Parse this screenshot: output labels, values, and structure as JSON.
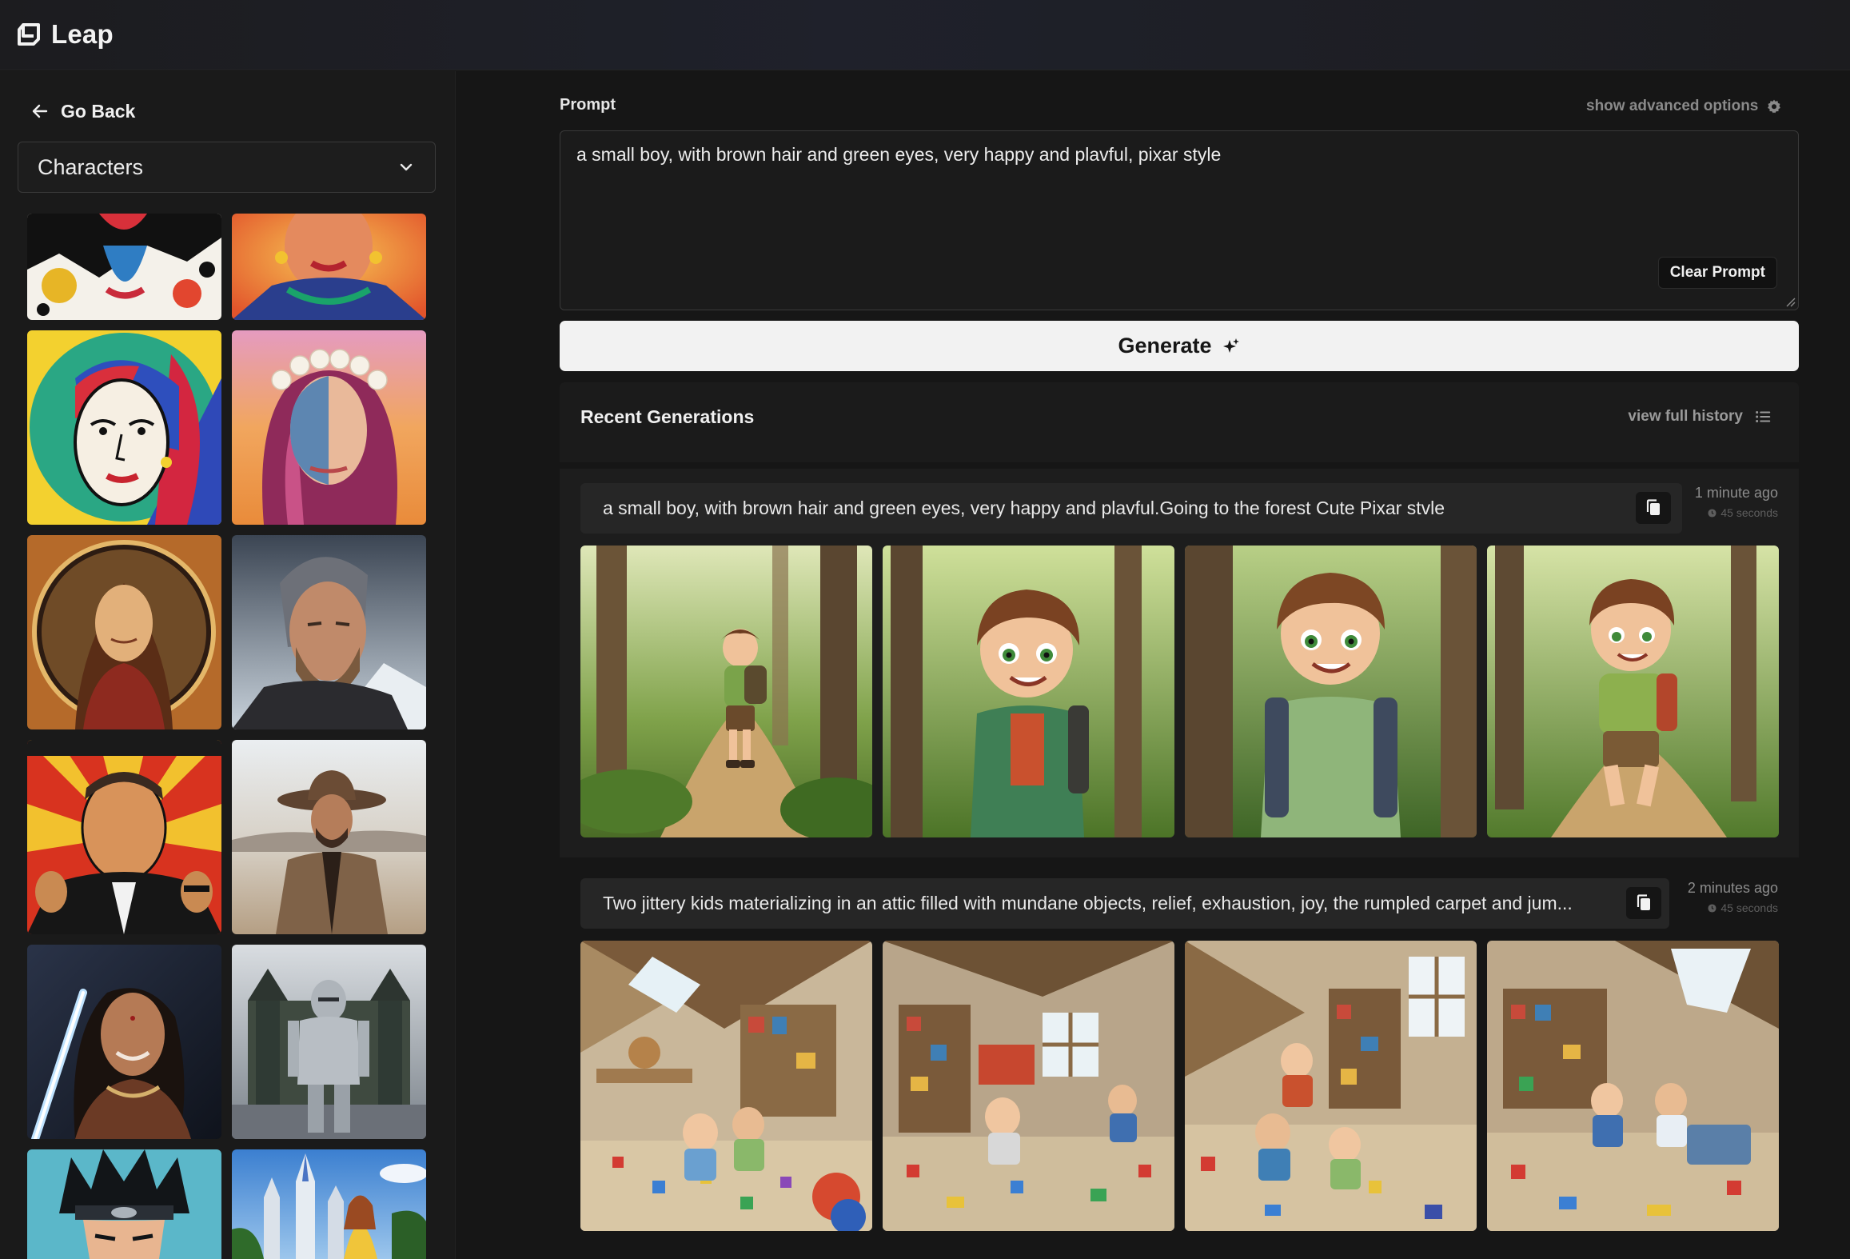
{
  "app": {
    "name": "Leap"
  },
  "sidebar": {
    "go_back_label": "Go Back",
    "category": {
      "selected": "Characters"
    },
    "tiles": [
      "pop-art-paint-splash-portrait",
      "pop-art-woman-with-necklace",
      "cubist-woman-portrait",
      "flower-crown-woman-portrait",
      "renaissance-woman-medallion",
      "viking-man-portrait",
      "retro-spy-poster",
      "cowboy-in-desert",
      "woman-with-lightsaber",
      "knight-in-armor",
      "anime-ninja",
      "princess-at-castle"
    ]
  },
  "prompt": {
    "label": "Prompt",
    "value": "a small boy, with brown hair and green eyes, very happy and plavful, pixar style",
    "advanced_label": "show advanced options",
    "clear_label": "Clear Prompt"
  },
  "generate": {
    "label": "Generate"
  },
  "recent": {
    "title": "Recent Generations",
    "view_history_label": "view full history",
    "generations": [
      {
        "prompt": "a small boy, with brown hair and green eyes, very happy and plavful.Going to the forest Cute Pixar stvle",
        "time": "1 minute ago",
        "duration": "45 seconds",
        "images": [
          "boy-walking-forest",
          "boy-smiling-forest",
          "boy-closeup-forest",
          "boy-running-forest"
        ]
      },
      {
        "prompt": "Two jittery kids materializing in an attic filled with mundane objects, relief, exhaustion, joy, the rumpled carpet and jum...",
        "time": "2 minutes ago",
        "duration": "45 seconds",
        "images": [
          "kids-in-attic-1",
          "kids-in-attic-2",
          "kids-in-attic-3",
          "kids-in-attic-4"
        ]
      }
    ]
  },
  "colors": {
    "background": "#161616",
    "panel": "#1b1b1b",
    "button_light": "#f2f2f2",
    "muted_text": "#8a8a8a"
  }
}
